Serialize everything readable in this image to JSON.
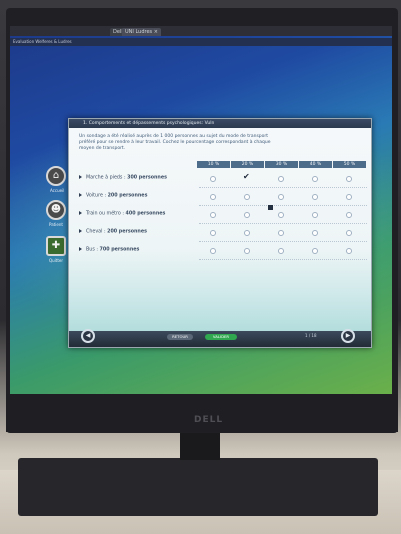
{
  "browser": {
    "tabs": [
      {
        "label": "Dell... ×"
      },
      {
        "label": "UNI Ludres ×"
      }
    ],
    "url": "Evaluation Welferes & Ludres"
  },
  "sidebar": {
    "items": [
      {
        "label": "Accueil",
        "icon": "house-icon"
      },
      {
        "label": "Patient",
        "icon": "person-icon"
      },
      {
        "label": "Quitter",
        "icon": "exit-icon"
      }
    ]
  },
  "dialog": {
    "title": "1. Comportements et dépassements psychologiques: Vuln",
    "instruction": "Un sondage a été réalisé auprès de 1 000 personnes au sujet du mode de transport préféré pour se rendre à leur travail. Cochez le pourcentage correspondant à chaque moyen de transport.",
    "columns": [
      "10 %",
      "20 %",
      "30 %",
      "40 %",
      "50 %"
    ],
    "rows": [
      {
        "label": "Marche à pieds :",
        "value": "300 personnes",
        "checked_col": 1
      },
      {
        "label": "Voiture :",
        "value": "200 personnes",
        "checked_col": -1
      },
      {
        "label": "Train ou métro :",
        "value": "400 personnes",
        "checked_col": -1
      },
      {
        "label": "Cheval :",
        "value": "200 personnes",
        "checked_col": -1
      },
      {
        "label": "Bus :",
        "value": "700 personnes",
        "checked_col": -1
      }
    ]
  },
  "footer": {
    "progress_label": "RETOUR",
    "validate_label": "VALIDER",
    "page_indicator": "1 / 18",
    "accent": "#2fa84f"
  },
  "monitor": {
    "brand": "DELL"
  }
}
